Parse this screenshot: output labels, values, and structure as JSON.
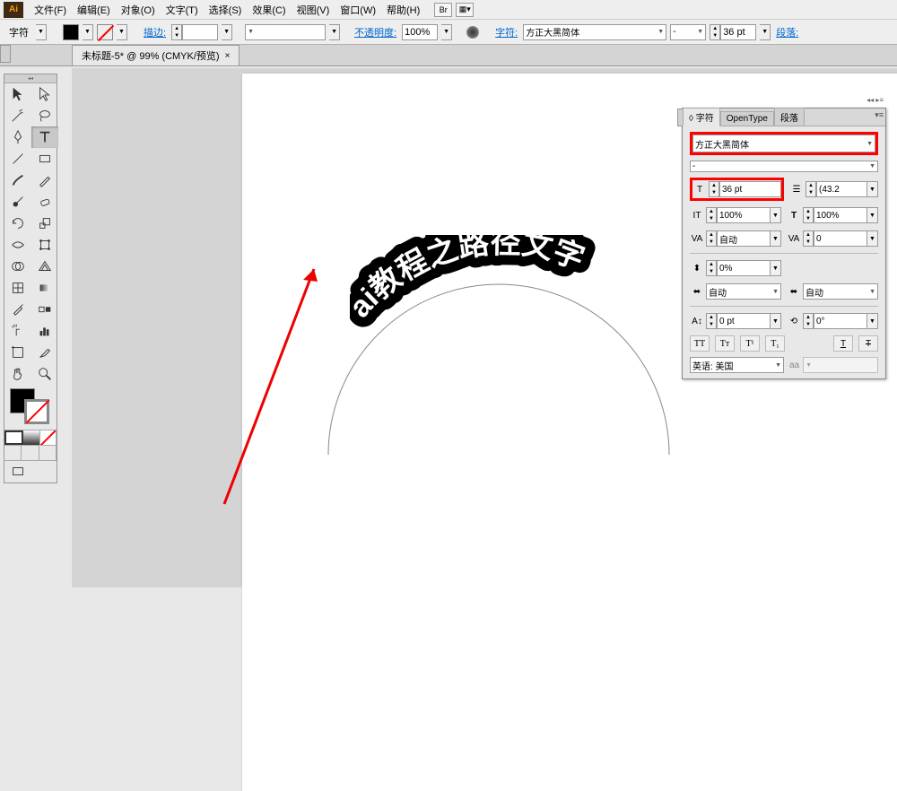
{
  "app": {
    "logo": "Ai"
  },
  "menu": {
    "items": [
      "文件(F)",
      "编辑(E)",
      "对象(O)",
      "文字(T)",
      "选择(S)",
      "效果(C)",
      "视图(V)",
      "窗口(W)",
      "帮助(H)"
    ],
    "extras": [
      "Br",
      "▦▾"
    ]
  },
  "controlbar": {
    "tool_label": "字符",
    "stroke_label": "描边:",
    "opacity_label": "不透明度:",
    "opacity_value": "100%",
    "char_link": "字符:",
    "font_family": "方正大黑简体",
    "font_style": "-",
    "font_size": "36 pt",
    "para_link": "段落:"
  },
  "document": {
    "tab_title": "未标题-5* @ 99% (CMYK/预览)"
  },
  "canvas": {
    "path_text": "ai教程之路径文字"
  },
  "char_panel": {
    "tabs": [
      "◊ 字符",
      "OpenType",
      "段落"
    ],
    "font_family": "方正大黑简体",
    "font_style": "-",
    "font_size": "36 pt",
    "leading": "(43.2",
    "hscale": "100%",
    "vscale": "100%",
    "kerning": "自动",
    "tracking": "0",
    "vshift": "0%",
    "akiL": "自动",
    "akiR": "自动",
    "baseline": "0 pt",
    "rotation": "0°",
    "language": "英语: 美国",
    "glyphs_label": "aa"
  },
  "tools": {
    "names": [
      "selection",
      "direct-select",
      "magic-wand",
      "lasso",
      "pen",
      "add-anchor",
      "type",
      "path-type",
      "line",
      "rect",
      "brush",
      "pencil",
      "blob",
      "eraser",
      "rotate",
      "reflect",
      "scale",
      "free-transform",
      "width",
      "warp",
      "shape-builder",
      "live-paint",
      "mesh",
      "gradient",
      "eyedropper",
      "measure",
      "blend",
      "symbol-spray",
      "graph",
      "artboard",
      "slice",
      "hand",
      "zoom"
    ]
  }
}
